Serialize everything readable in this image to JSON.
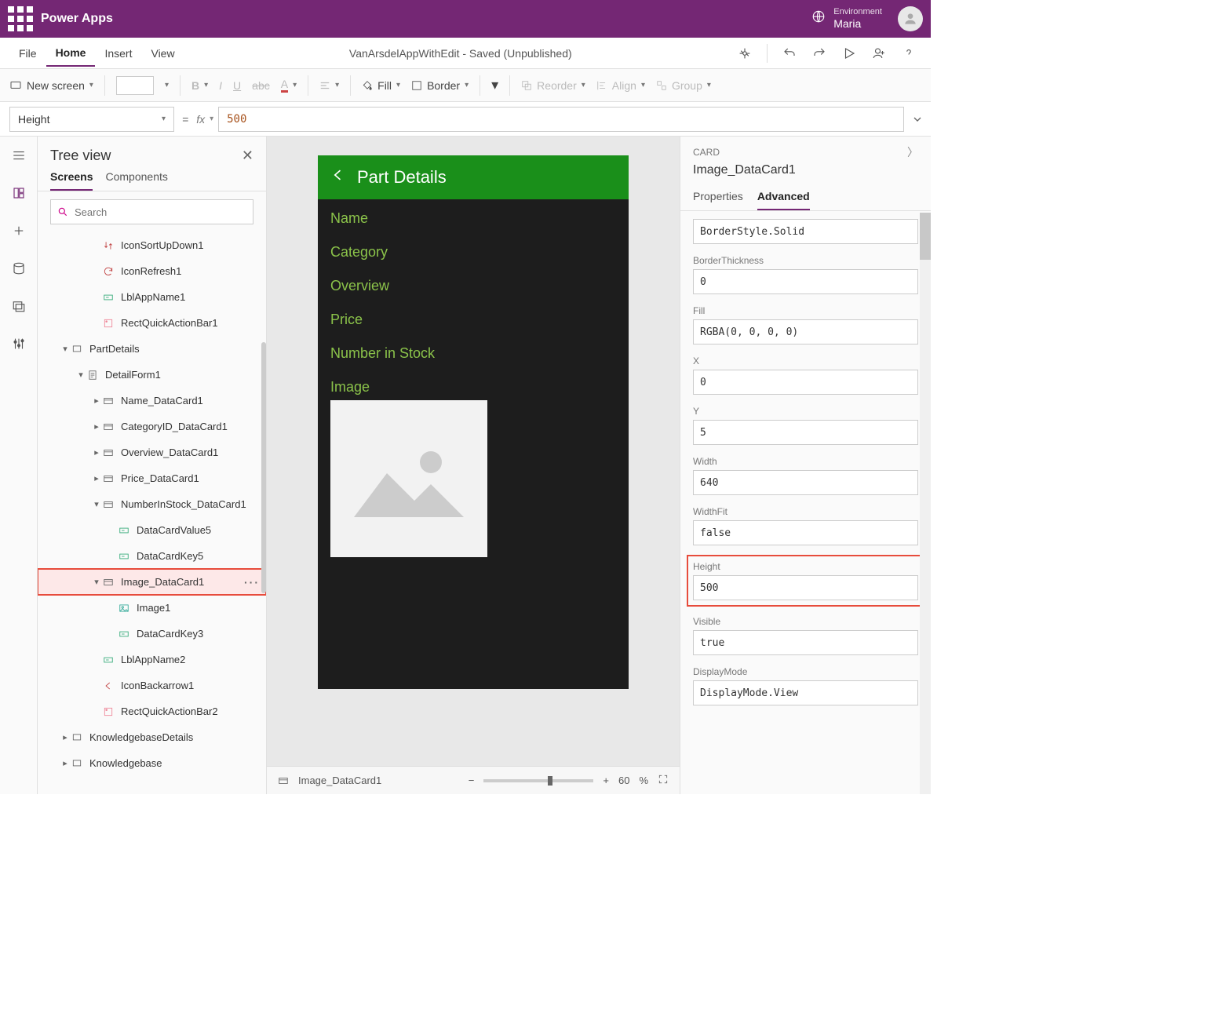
{
  "header": {
    "app_title": "Power Apps",
    "env_label": "Environment",
    "env_name": "Maria"
  },
  "menubar": {
    "items": [
      {
        "label": "File"
      },
      {
        "label": "Home"
      },
      {
        "label": "Insert"
      },
      {
        "label": "View"
      }
    ],
    "doc_title": "VanArsdelAppWithEdit - Saved (Unpublished)"
  },
  "toolbar": {
    "new_screen": "New screen",
    "fill": "Fill",
    "border": "Border",
    "reorder": "Reorder",
    "align": "Align",
    "group": "Group"
  },
  "formulabar": {
    "property": "Height",
    "value": "500",
    "fx": "fx"
  },
  "tree": {
    "title": "Tree view",
    "tabs": {
      "screens": "Screens",
      "components": "Components"
    },
    "search_placeholder": "Search",
    "items": [
      {
        "depth": 3,
        "icon": "sort",
        "label": "IconSortUpDown1"
      },
      {
        "depth": 3,
        "icon": "refresh",
        "label": "IconRefresh1"
      },
      {
        "depth": 3,
        "icon": "label",
        "label": "LblAppName1"
      },
      {
        "depth": 3,
        "icon": "rect",
        "label": "RectQuickActionBar1"
      },
      {
        "depth": 1,
        "icon": "screen",
        "label": "PartDetails",
        "chevron": "down"
      },
      {
        "depth": 2,
        "icon": "form",
        "label": "DetailForm1",
        "chevron": "down"
      },
      {
        "depth": 3,
        "icon": "card",
        "label": "Name_DataCard1",
        "chevron": "right"
      },
      {
        "depth": 3,
        "icon": "card",
        "label": "CategoryID_DataCard1",
        "chevron": "right"
      },
      {
        "depth": 3,
        "icon": "card",
        "label": "Overview_DataCard1",
        "chevron": "right"
      },
      {
        "depth": 3,
        "icon": "card",
        "label": "Price_DataCard1",
        "chevron": "right"
      },
      {
        "depth": 3,
        "icon": "card",
        "label": "NumberInStock_DataCard1",
        "chevron": "down"
      },
      {
        "depth": 4,
        "icon": "label",
        "label": "DataCardValue5"
      },
      {
        "depth": 4,
        "icon": "label",
        "label": "DataCardKey5"
      },
      {
        "depth": 3,
        "icon": "card",
        "label": "Image_DataCard1",
        "chevron": "down",
        "selected": true,
        "more": true
      },
      {
        "depth": 4,
        "icon": "image",
        "label": "Image1"
      },
      {
        "depth": 4,
        "icon": "label",
        "label": "DataCardKey3"
      },
      {
        "depth": 3,
        "icon": "label",
        "label": "LblAppName2"
      },
      {
        "depth": 3,
        "icon": "back",
        "label": "IconBackarrow1"
      },
      {
        "depth": 3,
        "icon": "rect",
        "label": "RectQuickActionBar2"
      },
      {
        "depth": 1,
        "icon": "screen",
        "label": "KnowledgebaseDetails",
        "chevron": "right"
      },
      {
        "depth": 1,
        "icon": "screen",
        "label": "Knowledgebase",
        "chevron": "right"
      }
    ]
  },
  "phone": {
    "title": "Part Details",
    "fields": [
      "Name",
      "Category",
      "Overview",
      "Price",
      "Number in Stock",
      "Image"
    ]
  },
  "canvas_footer": {
    "breadcrumb": "Image_DataCard1",
    "zoom": "60",
    "zoom_suffix": "%"
  },
  "props": {
    "type": "CARD",
    "name": "Image_DataCard1",
    "tabs": {
      "properties": "Properties",
      "advanced": "Advanced"
    },
    "fields": [
      {
        "label": "",
        "value": "BorderStyle.Solid"
      },
      {
        "label": "BorderThickness",
        "value": "0"
      },
      {
        "label": "Fill",
        "value": "RGBA(0, 0, 0, 0)"
      },
      {
        "label": "X",
        "value": "0"
      },
      {
        "label": "Y",
        "value": "5"
      },
      {
        "label": "Width",
        "value": "640"
      },
      {
        "label": "WidthFit",
        "value": "false"
      },
      {
        "label": "Height",
        "value": "500",
        "highlighted": true
      },
      {
        "label": "Visible",
        "value": "true"
      },
      {
        "label": "DisplayMode",
        "value": "DisplayMode.View"
      }
    ]
  }
}
